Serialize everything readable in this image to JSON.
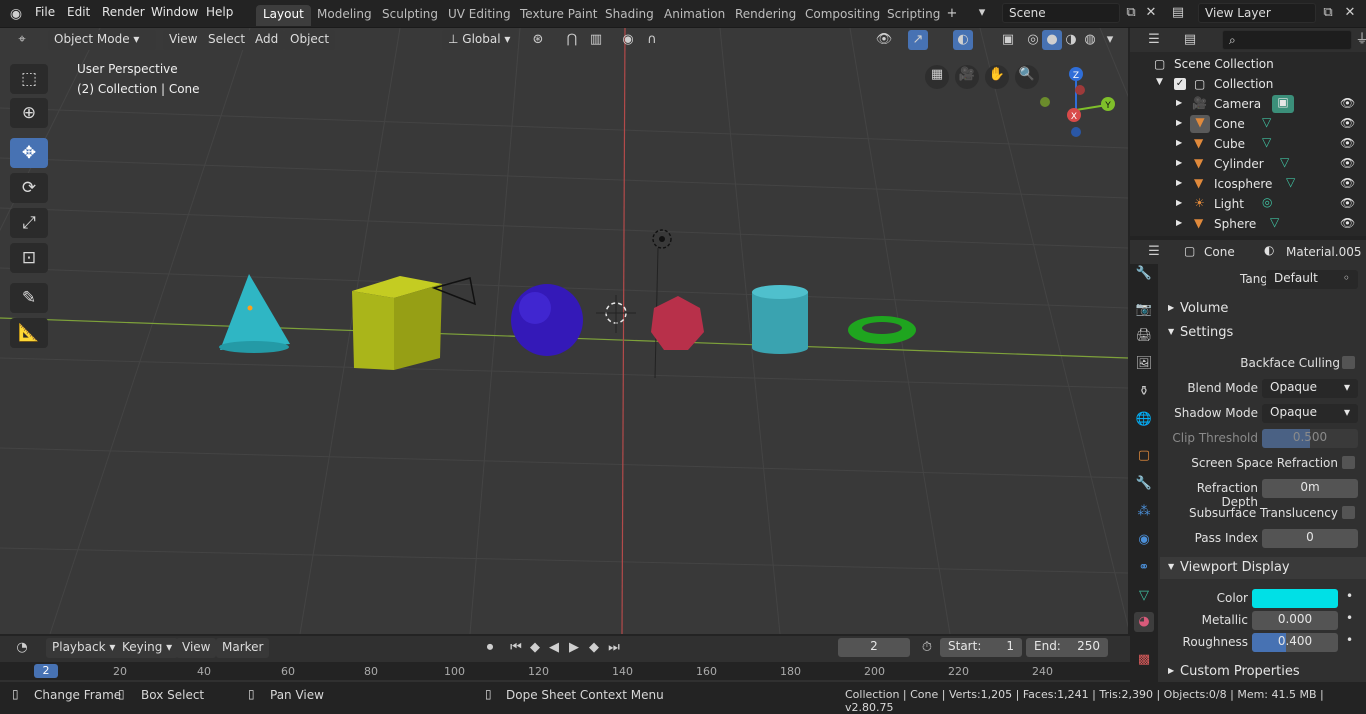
{
  "menus": [
    "File",
    "Edit",
    "Render",
    "Window",
    "Help"
  ],
  "workspaces": [
    "Layout",
    "Modeling",
    "Sculpting",
    "UV Editing",
    "Texture Paint",
    "Shading",
    "Animation",
    "Rendering",
    "Compositing",
    "Scripting"
  ],
  "scene": {
    "label": "Scene"
  },
  "view_layer": {
    "label": "View Layer"
  },
  "viewport_header": {
    "mode": "Object Mode",
    "view": "View",
    "select": "Select",
    "add": "Add",
    "object": "Object",
    "orientation": "Global"
  },
  "viewport": {
    "perspective": "User Perspective",
    "collection_info": "(2) Collection | Cone",
    "gizmo": {
      "z": "Z",
      "y": "Y",
      "x": "X"
    }
  },
  "outliner": {
    "scene_collection": "Scene Collection",
    "collection": "Collection",
    "items": [
      {
        "name": "Camera",
        "type": "camera"
      },
      {
        "name": "Cone",
        "type": "mesh"
      },
      {
        "name": "Cube",
        "type": "mesh"
      },
      {
        "name": "Cylinder",
        "type": "mesh"
      },
      {
        "name": "Icosphere",
        "type": "mesh"
      },
      {
        "name": "Light",
        "type": "light"
      },
      {
        "name": "Sphere",
        "type": "mesh"
      }
    ]
  },
  "properties": {
    "object": "Cone",
    "material": "Material.005",
    "tangent_label": "Tangent",
    "tangent_value": "Default",
    "sections": {
      "volume": "Volume",
      "settings": "Settings",
      "viewport_display": "Viewport Display",
      "custom_properties": "Custom Properties"
    },
    "backface_culling": "Backface Culling",
    "blend_mode_label": "Blend Mode",
    "blend_mode": "Opaque",
    "shadow_mode_label": "Shadow Mode",
    "shadow_mode": "Opaque",
    "clip_threshold_label": "Clip Threshold",
    "clip_threshold": "0.500",
    "clip_threshold_fraction": 0.5,
    "ssr_label": "Screen Space Refraction",
    "refraction_depth_label": "Refraction Depth",
    "refraction_depth": "0m",
    "sss_label": "Subsurface Translucency",
    "pass_index_label": "Pass Index",
    "pass_index": "0",
    "color_label": "Color",
    "color_value": "#00e0e6",
    "metallic_label": "Metallic",
    "metallic": "0.000",
    "roughness_label": "Roughness",
    "roughness": "0.400",
    "roughness_fraction": 0.4
  },
  "timeline": {
    "playback": "Playback",
    "keying": "Keying",
    "view": "View",
    "marker": "Marker",
    "current_frame": "2",
    "start_label": "Start:",
    "start": "1",
    "end_label": "End:",
    "end": "250",
    "ruler": [
      "2",
      "20",
      "40",
      "60",
      "80",
      "100",
      "120",
      "140",
      "160",
      "180",
      "200",
      "220",
      "240"
    ]
  },
  "status": {
    "change_frame": "Change Frame",
    "box_select": "Box Select",
    "pan_view": "Pan View",
    "context_menu": "Dope Sheet Context Menu",
    "stats": "Collection | Cone | Verts:1,205 | Faces:1,241 | Tris:2,390 | Objects:0/8 | Mem: 41.5 MB | v2.80.75"
  },
  "colors": {
    "accent": "#4772b3",
    "active_tab": "#3d3d3d",
    "viewport_bg": "#393939"
  }
}
